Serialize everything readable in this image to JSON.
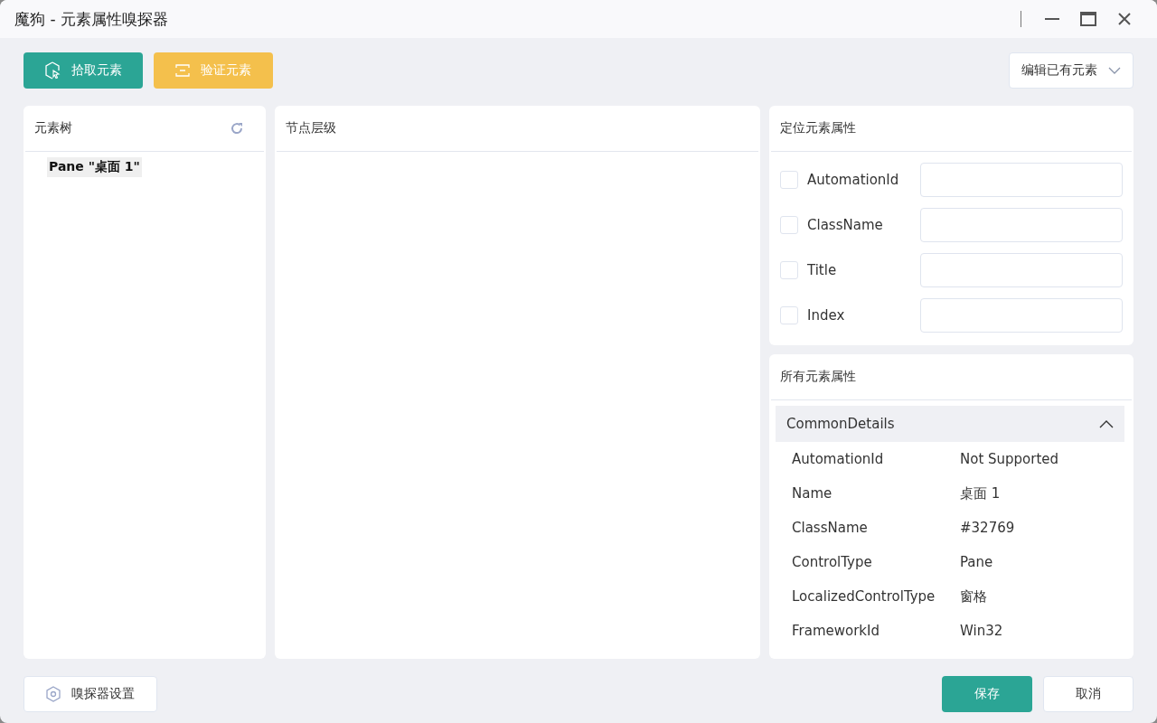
{
  "window": {
    "title": "魔狗 - 元素属性嗅探器"
  },
  "toolbar": {
    "pick_button": "拾取元素",
    "verify_button": "验证元素",
    "edit_dropdown": "编辑已有元素"
  },
  "element_tree": {
    "title": "元素树",
    "items": [
      {
        "label": "Pane \"桌面 1\"",
        "selected": true
      }
    ]
  },
  "node_levels": {
    "title": "节点层级"
  },
  "locator_properties": {
    "title": "定位元素属性",
    "rows": [
      {
        "label": "AutomationId",
        "checked": false,
        "value": ""
      },
      {
        "label": "ClassName",
        "checked": false,
        "value": ""
      },
      {
        "label": "Title",
        "checked": false,
        "value": ""
      },
      {
        "label": "Index",
        "checked": false,
        "value": ""
      }
    ]
  },
  "all_properties": {
    "title": "所有元素属性",
    "section": {
      "title": "CommonDetails",
      "expanded": true,
      "rows": [
        {
          "name": "AutomationId",
          "value": "Not Supported"
        },
        {
          "name": "Name",
          "value": "桌面 1"
        },
        {
          "name": "ClassName",
          "value": "#32769"
        },
        {
          "name": "ControlType",
          "value": "Pane"
        },
        {
          "name": "LocalizedControlType",
          "value": "窗格"
        },
        {
          "name": "FrameworkId",
          "value": "Win32"
        }
      ]
    }
  },
  "footer": {
    "settings_button": "嗅探器设置",
    "save_button": "保存",
    "cancel_button": "取消"
  }
}
